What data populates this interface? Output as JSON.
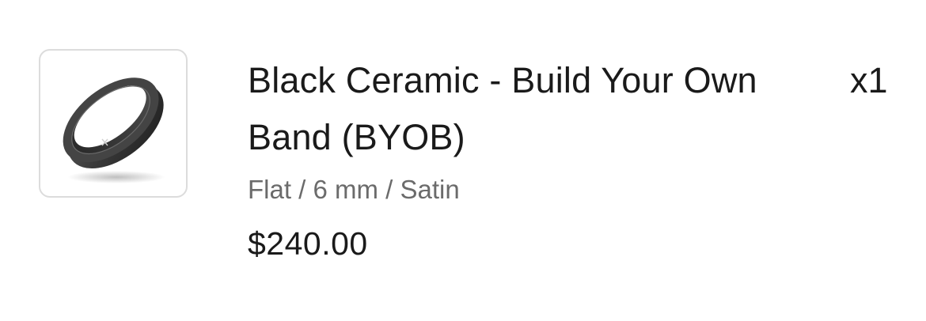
{
  "cart_item": {
    "image_icon": "black-ceramic-ring",
    "title": "Black Ceramic - Build Your Own Band (BYOB)",
    "quantity": "x1",
    "variant": "Flat / 6 mm / Satin",
    "price": "$240.00"
  }
}
